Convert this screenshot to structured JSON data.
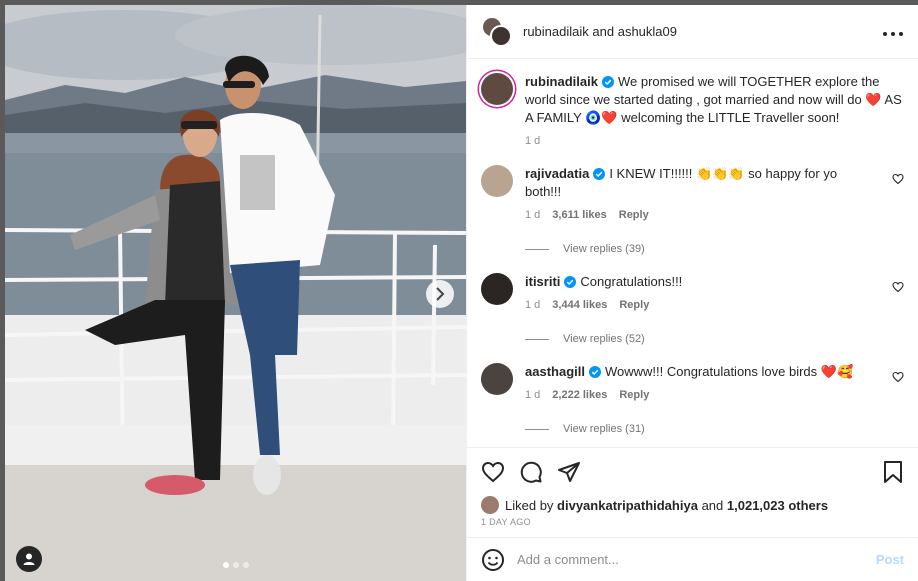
{
  "header": {
    "user1": "rubinadilaik",
    "joiner": "and",
    "user2": "ashukla09"
  },
  "caption": {
    "username": "rubinadilaik",
    "text": "We promised we will TOGETHER explore the world since we started dating , got married and now will do ❤️ AS A FAMILY 🧿❤️ welcoming the LITTLE Traveller soon!",
    "time": "1 d"
  },
  "comments": [
    {
      "username": "rajivadatia",
      "text": "I KNEW IT!!!!!! 👏👏👏 so happy for yo both!!!",
      "time": "1 d",
      "likes": "3,611 likes",
      "reply": "Reply",
      "view_replies": "View replies (39)",
      "avatar_color": "#b9a391"
    },
    {
      "username": "itisriti",
      "text": "Congratulations!!!",
      "time": "1 d",
      "likes": "3,444 likes",
      "reply": "Reply",
      "view_replies": "View replies (52)",
      "avatar_color": "#2b2623"
    },
    {
      "username": "aasthagill",
      "text": "Wowww!!! Congratulations love birds ❤️🥰",
      "time": "1 d",
      "likes": "2,222 likes",
      "reply": "Reply",
      "view_replies": "View replies (31)",
      "avatar_color": "#4a4340"
    }
  ],
  "likes": {
    "prefix": "Liked by",
    "user": "divyankatripathidahiya",
    "joiner": "and",
    "count": "1,021,023 others"
  },
  "posted_ago": "1 DAY AGO",
  "comment_box": {
    "placeholder": "Add a comment...",
    "post_label": "Post"
  },
  "colors": {
    "verified": "#0095f6",
    "story_ring": "#d6249f",
    "post_disabled": "#b3dbff"
  },
  "carousel": {
    "slides": 3,
    "active": 1
  }
}
